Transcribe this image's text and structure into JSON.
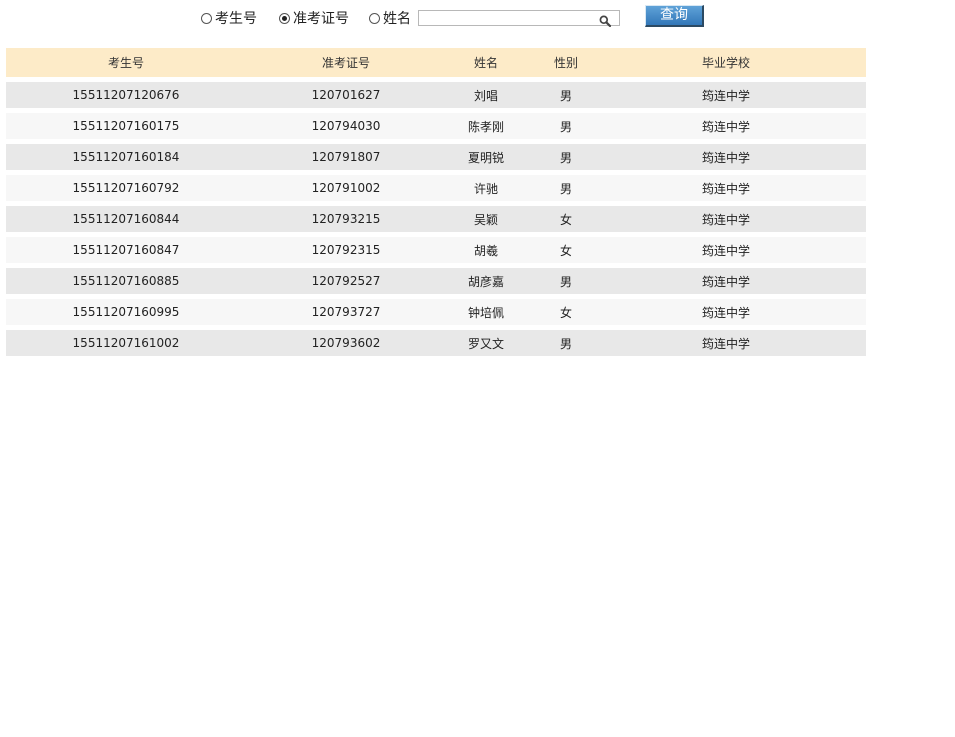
{
  "search": {
    "options": [
      {
        "label": "考生号",
        "checked": false
      },
      {
        "label": "准考证号",
        "checked": true
      },
      {
        "label": "姓名",
        "checked": false
      }
    ],
    "input_value": "",
    "query_label": "查询"
  },
  "table": {
    "headers": [
      "考生号",
      "准考证号",
      "姓名",
      "性别",
      "毕业学校"
    ],
    "rows": [
      [
        "15511207120676",
        "120701627",
        "刘唱",
        "男",
        "筠连中学"
      ],
      [
        "15511207160175",
        "120794030",
        "陈孝刚",
        "男",
        "筠连中学"
      ],
      [
        "15511207160184",
        "120791807",
        "夏明锐",
        "男",
        "筠连中学"
      ],
      [
        "15511207160792",
        "120791002",
        "许驰",
        "男",
        "筠连中学"
      ],
      [
        "15511207160844",
        "120793215",
        "吴颖",
        "女",
        "筠连中学"
      ],
      [
        "15511207160847",
        "120792315",
        "胡羲",
        "女",
        "筠连中学"
      ],
      [
        "15511207160885",
        "120792527",
        "胡彦嘉",
        "男",
        "筠连中学"
      ],
      [
        "15511207160995",
        "120793727",
        "钟培佩",
        "女",
        "筠连中学"
      ],
      [
        "15511207161002",
        "120793602",
        "罗又文",
        "男",
        "筠连中学"
      ]
    ]
  },
  "icons": {
    "search": "magnifier-icon"
  },
  "colors": {
    "header_bg": "#fdebc8",
    "row_odd": "#e8e8e8",
    "row_even": "#f7f7f7",
    "button_bg": "#3b84c4"
  }
}
